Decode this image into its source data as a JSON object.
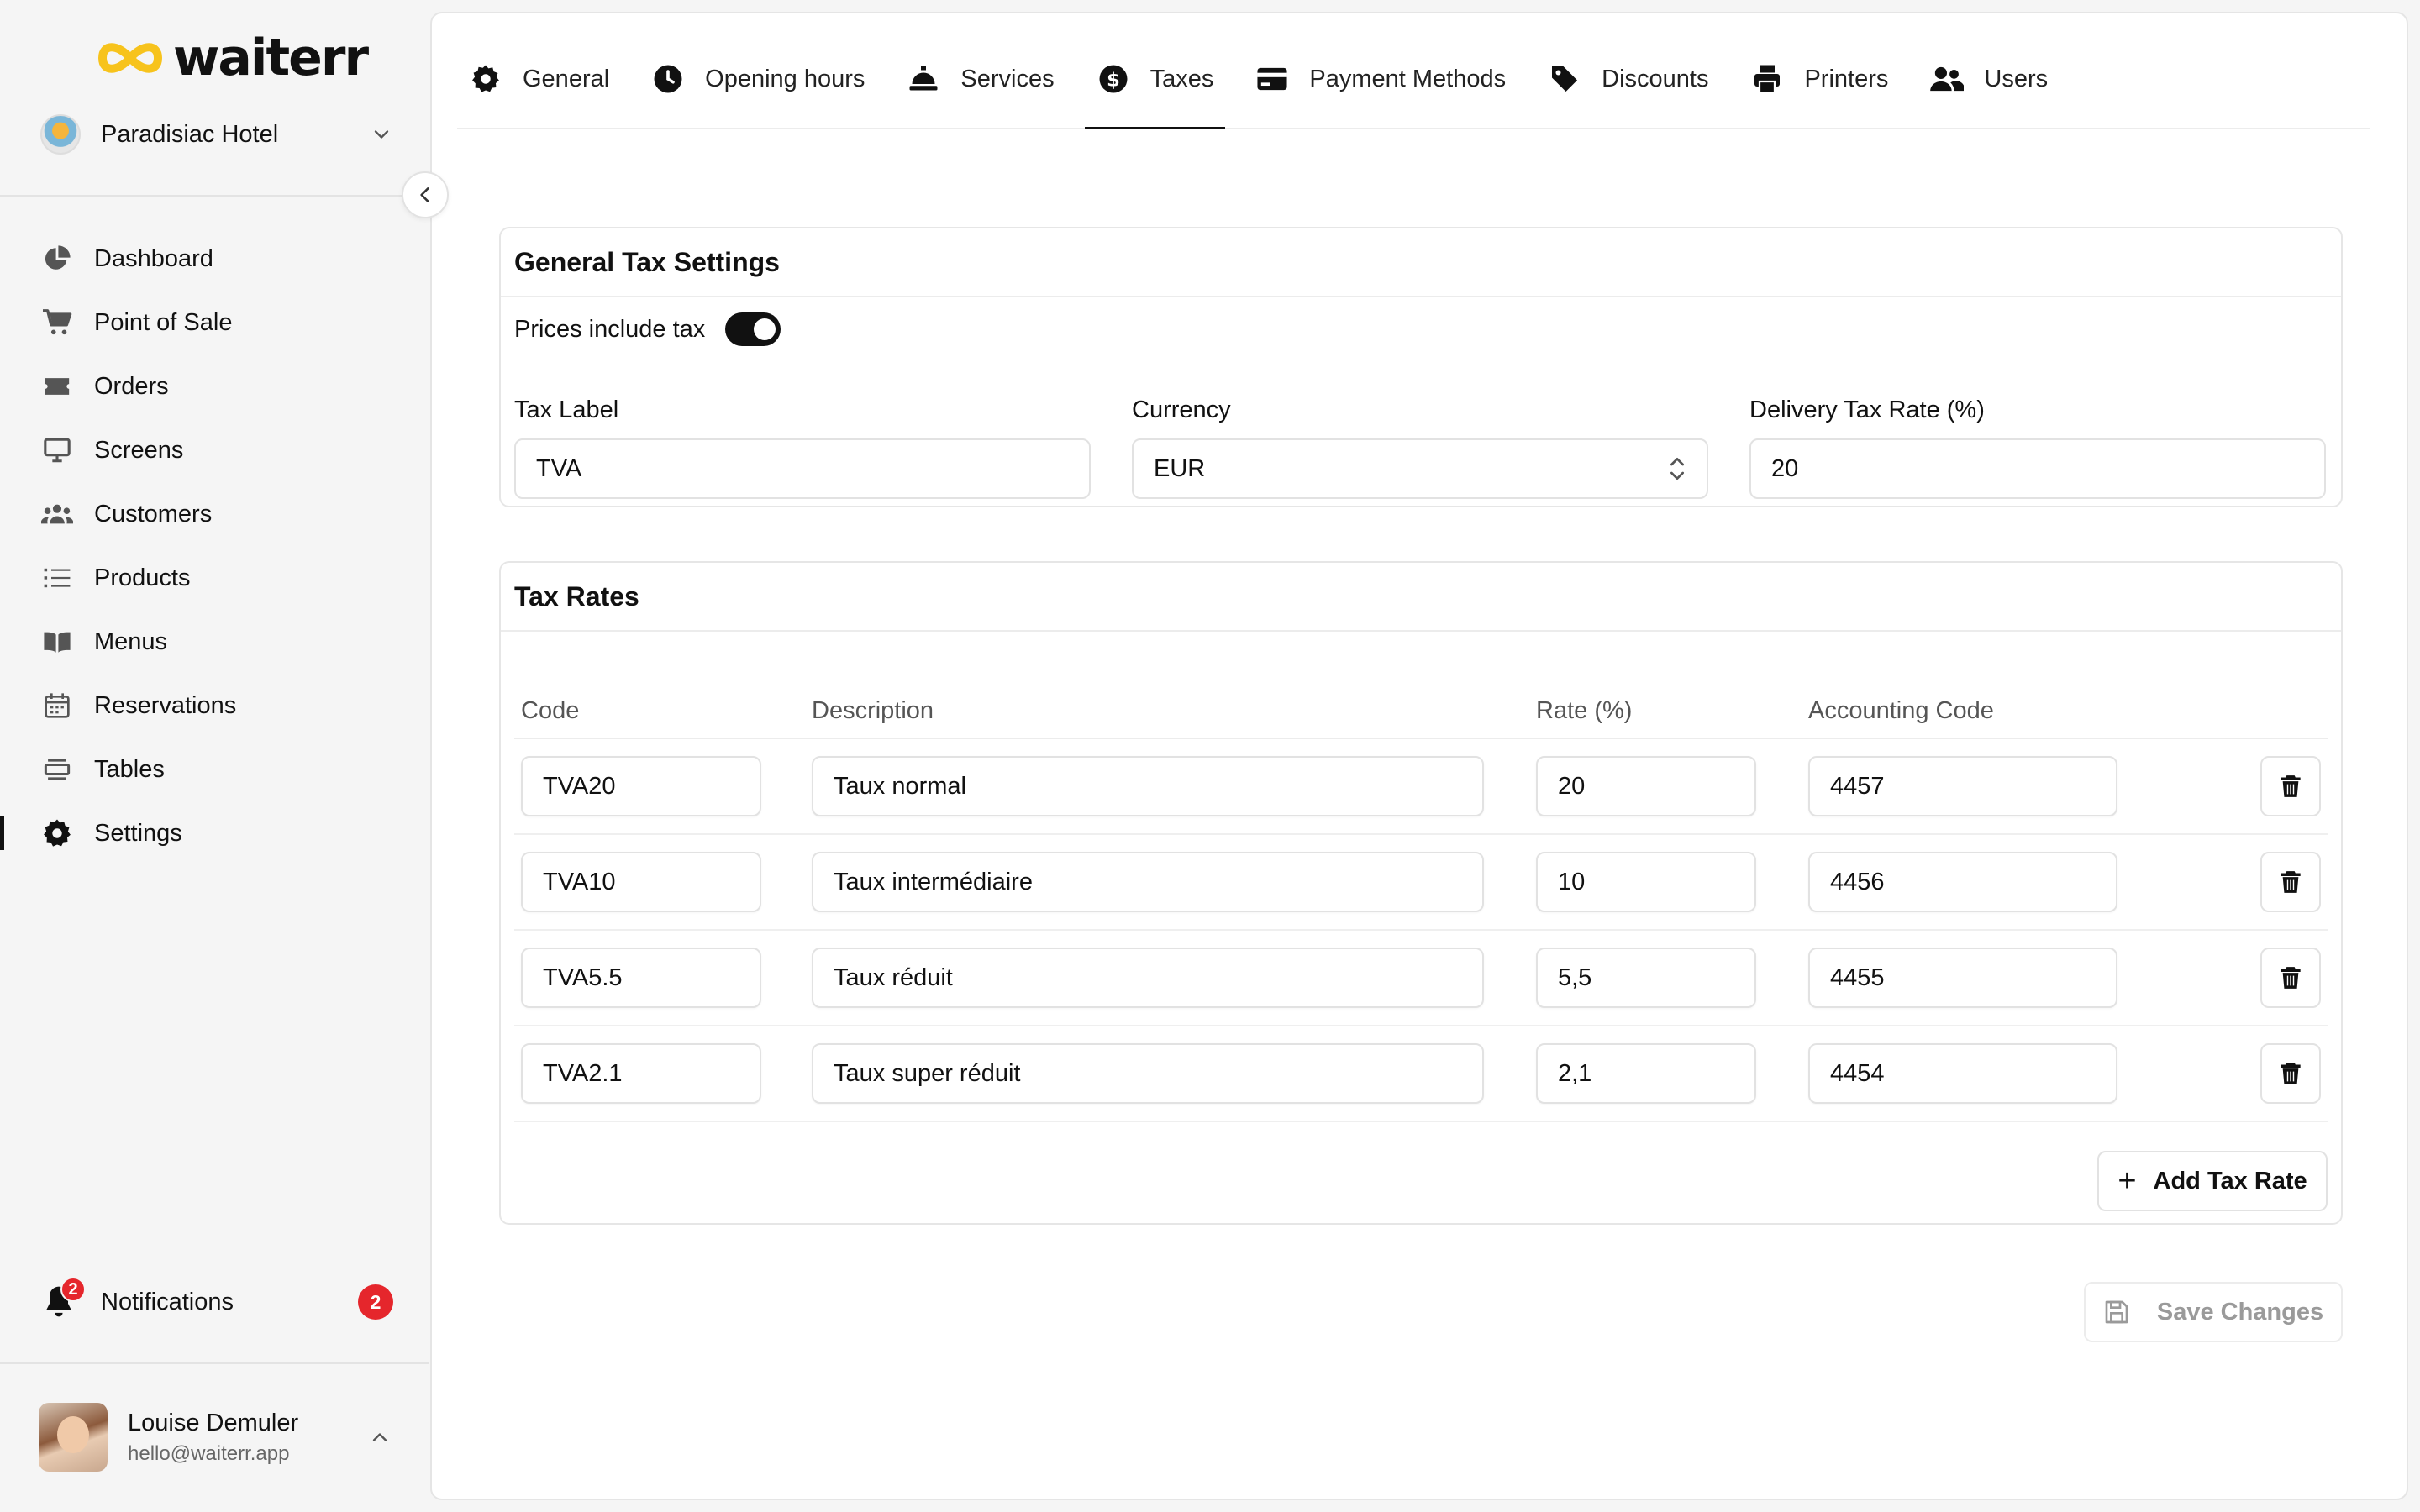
{
  "app": {
    "logo_text": "waiterr",
    "brand_color": "#f7c31c"
  },
  "hotel": {
    "name": "Paradisiac Hotel"
  },
  "sidebar": {
    "items": [
      {
        "label": "Dashboard",
        "icon": "pie-chart-icon"
      },
      {
        "label": "Point of Sale",
        "icon": "cart-icon"
      },
      {
        "label": "Orders",
        "icon": "ticket-icon"
      },
      {
        "label": "Screens",
        "icon": "monitor-icon"
      },
      {
        "label": "Customers",
        "icon": "users-icon"
      },
      {
        "label": "Products",
        "icon": "list-icon"
      },
      {
        "label": "Menus",
        "icon": "book-icon"
      },
      {
        "label": "Reservations",
        "icon": "calendar-icon"
      },
      {
        "label": "Tables",
        "icon": "table-icon"
      },
      {
        "label": "Settings",
        "icon": "gear-icon",
        "active": true
      }
    ],
    "notifications": {
      "label": "Notifications",
      "count": "2"
    },
    "user": {
      "name": "Louise Demuler",
      "email": "hello@waiterr.app"
    }
  },
  "tabs": [
    {
      "label": "General",
      "icon": "gear-icon"
    },
    {
      "label": "Opening hours",
      "icon": "clock-icon"
    },
    {
      "label": "Services",
      "icon": "cloche-icon"
    },
    {
      "label": "Taxes",
      "icon": "dollar-icon",
      "active": true
    },
    {
      "label": "Payment Methods",
      "icon": "credit-card-icon"
    },
    {
      "label": "Discounts",
      "icon": "tag-icon"
    },
    {
      "label": "Printers",
      "icon": "printer-icon"
    },
    {
      "label": "Users",
      "icon": "user-group-icon"
    }
  ],
  "general": {
    "title": "General Tax Settings",
    "prices_include_tax_label": "Prices include tax",
    "prices_include_tax": true,
    "tax_label": {
      "label": "Tax Label",
      "value": "TVA"
    },
    "currency": {
      "label": "Currency",
      "value": "EUR"
    },
    "delivery_rate": {
      "label": "Delivery Tax Rate (%)",
      "value": "20"
    }
  },
  "tax_rates": {
    "title": "Tax Rates",
    "columns": {
      "code": "Code",
      "description": "Description",
      "rate": "Rate (%)",
      "accounting": "Accounting Code"
    },
    "rows": [
      {
        "code": "TVA20",
        "description": "Taux normal",
        "rate": "20",
        "accounting": "4457"
      },
      {
        "code": "TVA10",
        "description": "Taux intermédiaire",
        "rate": "10",
        "accounting": "4456"
      },
      {
        "code": "TVA5.5",
        "description": "Taux réduit",
        "rate": "5,5",
        "accounting": "4455"
      },
      {
        "code": "TVA2.1",
        "description": "Taux super réduit",
        "rate": "2,1",
        "accounting": "4454"
      }
    ],
    "add_label": "Add Tax Rate"
  },
  "save_label": "Save Changes"
}
